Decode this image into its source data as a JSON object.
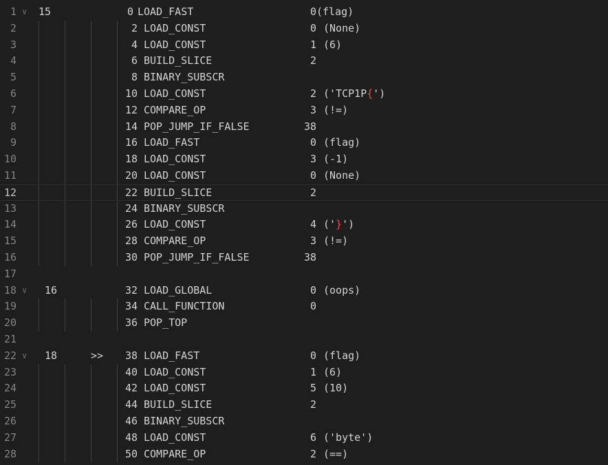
{
  "lines": [
    {
      "n": "1",
      "fold": true,
      "src": "15",
      "marker": "",
      "offset": "0",
      "op": "LOAD_FAST",
      "arg": "0",
      "repr": "(flag)",
      "guides": false
    },
    {
      "n": "2",
      "fold": false,
      "src": "",
      "marker": "",
      "offset": "2",
      "op": "LOAD_CONST",
      "arg": "0",
      "repr": "(None)",
      "guides": true
    },
    {
      "n": "3",
      "fold": false,
      "src": "",
      "marker": "",
      "offset": "4",
      "op": "LOAD_CONST",
      "arg": "1",
      "repr": "(6)",
      "guides": true
    },
    {
      "n": "4",
      "fold": false,
      "src": "",
      "marker": "",
      "offset": "6",
      "op": "BUILD_SLICE",
      "arg": "2",
      "repr": "",
      "guides": true
    },
    {
      "n": "5",
      "fold": false,
      "src": "",
      "marker": "",
      "offset": "8",
      "op": "BINARY_SUBSCR",
      "arg": "",
      "repr": "",
      "guides": true
    },
    {
      "n": "6",
      "fold": false,
      "src": "",
      "marker": "",
      "offset": "10",
      "op": "LOAD_CONST",
      "arg": "2",
      "repr": "('TCP1P{')",
      "guides": true,
      "brace": "pre"
    },
    {
      "n": "7",
      "fold": false,
      "src": "",
      "marker": "",
      "offset": "12",
      "op": "COMPARE_OP",
      "arg": "3",
      "repr": "(!=)",
      "guides": true
    },
    {
      "n": "8",
      "fold": false,
      "src": "",
      "marker": "",
      "offset": "14",
      "op": "POP_JUMP_IF_FALSE",
      "arg": "38",
      "repr": "",
      "guides": true
    },
    {
      "n": "9",
      "fold": false,
      "src": "",
      "marker": "",
      "offset": "16",
      "op": "LOAD_FAST",
      "arg": "0",
      "repr": "(flag)",
      "guides": true
    },
    {
      "n": "10",
      "fold": false,
      "src": "",
      "marker": "",
      "offset": "18",
      "op": "LOAD_CONST",
      "arg": "3",
      "repr": "(-1)",
      "guides": true
    },
    {
      "n": "11",
      "fold": false,
      "src": "",
      "marker": "",
      "offset": "20",
      "op": "LOAD_CONST",
      "arg": "0",
      "repr": "(None)",
      "guides": true
    },
    {
      "n": "12",
      "fold": false,
      "src": "",
      "marker": "",
      "offset": "22",
      "op": "BUILD_SLICE",
      "arg": "2",
      "repr": "",
      "guides": true,
      "current": true
    },
    {
      "n": "13",
      "fold": false,
      "src": "",
      "marker": "",
      "offset": "24",
      "op": "BINARY_SUBSCR",
      "arg": "",
      "repr": "",
      "guides": true
    },
    {
      "n": "14",
      "fold": false,
      "src": "",
      "marker": "",
      "offset": "26",
      "op": "LOAD_CONST",
      "arg": "4",
      "repr": "('}')",
      "guides": true,
      "brace": "close"
    },
    {
      "n": "15",
      "fold": false,
      "src": "",
      "marker": "",
      "offset": "28",
      "op": "COMPARE_OP",
      "arg": "3",
      "repr": "(!=)",
      "guides": true
    },
    {
      "n": "16",
      "fold": false,
      "src": "",
      "marker": "",
      "offset": "30",
      "op": "POP_JUMP_IF_FALSE",
      "arg": "38",
      "repr": "",
      "guides": true
    },
    {
      "n": "17",
      "fold": false,
      "src": "",
      "marker": "",
      "offset": "",
      "op": "",
      "arg": "",
      "repr": "",
      "guides": false
    },
    {
      "n": "18",
      "fold": true,
      "src": "16",
      "marker": "",
      "offset": "32",
      "op": "LOAD_GLOBAL",
      "arg": "0",
      "repr": "(oops)",
      "guides": false,
      "wide": true
    },
    {
      "n": "19",
      "fold": false,
      "src": "",
      "marker": "",
      "offset": "34",
      "op": "CALL_FUNCTION",
      "arg": "0",
      "repr": "",
      "guides": true
    },
    {
      "n": "20",
      "fold": false,
      "src": "",
      "marker": "",
      "offset": "36",
      "op": "POP_TOP",
      "arg": "",
      "repr": "",
      "guides": true
    },
    {
      "n": "21",
      "fold": false,
      "src": "",
      "marker": "",
      "offset": "",
      "op": "",
      "arg": "",
      "repr": "",
      "guides": false
    },
    {
      "n": "22",
      "fold": true,
      "src": "18",
      "marker": ">>",
      "offset": "38",
      "op": "LOAD_FAST",
      "arg": "0",
      "repr": "(flag)",
      "guides": false,
      "wide": true
    },
    {
      "n": "23",
      "fold": false,
      "src": "",
      "marker": "",
      "offset": "40",
      "op": "LOAD_CONST",
      "arg": "1",
      "repr": "(6)",
      "guides": true
    },
    {
      "n": "24",
      "fold": false,
      "src": "",
      "marker": "",
      "offset": "42",
      "op": "LOAD_CONST",
      "arg": "5",
      "repr": "(10)",
      "guides": true
    },
    {
      "n": "25",
      "fold": false,
      "src": "",
      "marker": "",
      "offset": "44",
      "op": "BUILD_SLICE",
      "arg": "2",
      "repr": "",
      "guides": true
    },
    {
      "n": "26",
      "fold": false,
      "src": "",
      "marker": "",
      "offset": "46",
      "op": "BINARY_SUBSCR",
      "arg": "",
      "repr": "",
      "guides": true
    },
    {
      "n": "27",
      "fold": false,
      "src": "",
      "marker": "",
      "offset": "48",
      "op": "LOAD_CONST",
      "arg": "6",
      "repr": "('byte')",
      "guides": true
    },
    {
      "n": "28",
      "fold": false,
      "src": "",
      "marker": "",
      "offset": "50",
      "op": "COMPARE_OP",
      "arg": "2",
      "repr": "(==)",
      "guides": true
    }
  ],
  "colors": {
    "background": "#1e1e1e",
    "text": "#d4d4d4",
    "gutter": "#858585",
    "guide": "#404040",
    "brace": "#f44747"
  },
  "icons": {
    "fold": "chevron-down-icon"
  }
}
